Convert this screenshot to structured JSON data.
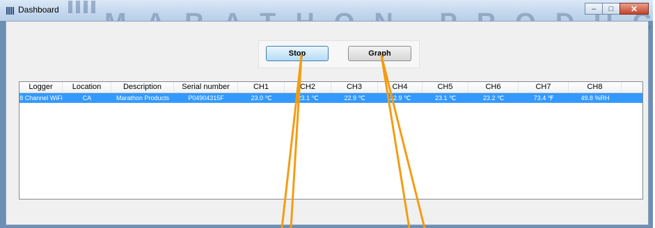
{
  "window": {
    "title": "Dashboard",
    "brand_text": "MARATHON PRODUCTS INC",
    "minimize_symbol": "–",
    "maximize_symbol": "□",
    "close_symbol": "✕"
  },
  "toolbar": {
    "stop_label": "Stop",
    "graph_label": "Graph"
  },
  "table": {
    "columns": [
      "Logger",
      "Location",
      "Description",
      "Serial number",
      "CH1",
      "CH2",
      "CH3",
      "CH4",
      "CH5",
      "CH6",
      "CH7",
      "CH8"
    ],
    "rows": [
      [
        "8 Channel WiFi",
        "CA",
        "Marathon Products",
        "P04904315F",
        "23.0 ℃",
        "23.1 ℃",
        "22.9 ℃",
        "22.9 ℃",
        "23.1 ℃",
        "23.2 ℃",
        "73.4 ℉",
        "49.8 %RH"
      ]
    ]
  },
  "colors": {
    "selection": "#3399ff",
    "annotation": "#f39c12"
  }
}
